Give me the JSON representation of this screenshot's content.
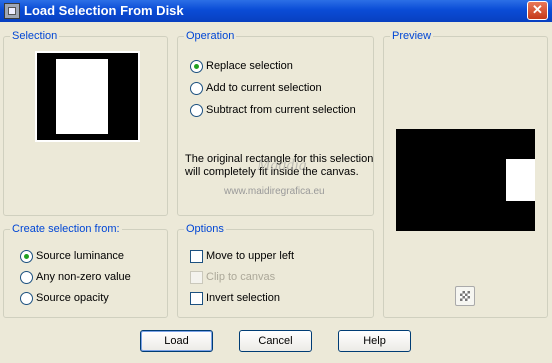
{
  "window": {
    "title": "Load Selection From Disk",
    "close_glyph": "✕"
  },
  "selection": {
    "legend": "Selection"
  },
  "operation": {
    "legend": "Operation",
    "options": [
      {
        "label": "Replace selection",
        "selected": true
      },
      {
        "label": "Add to current selection",
        "selected": false
      },
      {
        "label": "Subtract from current selection",
        "selected": false
      }
    ],
    "description": "The original rectangle for this selection will completely fit inside the canvas."
  },
  "preview": {
    "legend": "Preview"
  },
  "create_from": {
    "legend": "Create selection from:",
    "options": [
      {
        "label": "Source luminance",
        "selected": true
      },
      {
        "label": "Any non-zero value",
        "selected": false
      },
      {
        "label": "Source opacity",
        "selected": false
      }
    ]
  },
  "options": {
    "legend": "Options",
    "items": [
      {
        "label": "Move to upper left",
        "checked": false,
        "enabled": true
      },
      {
        "label": "Clip to canvas",
        "checked": false,
        "enabled": false
      },
      {
        "label": "Invert selection",
        "checked": false,
        "enabled": true
      }
    ]
  },
  "watermark": {
    "line1": "Maddia",
    "line2": "www.maidiregrafica.eu"
  },
  "buttons": {
    "load": "Load",
    "cancel": "Cancel",
    "help": "Help"
  }
}
